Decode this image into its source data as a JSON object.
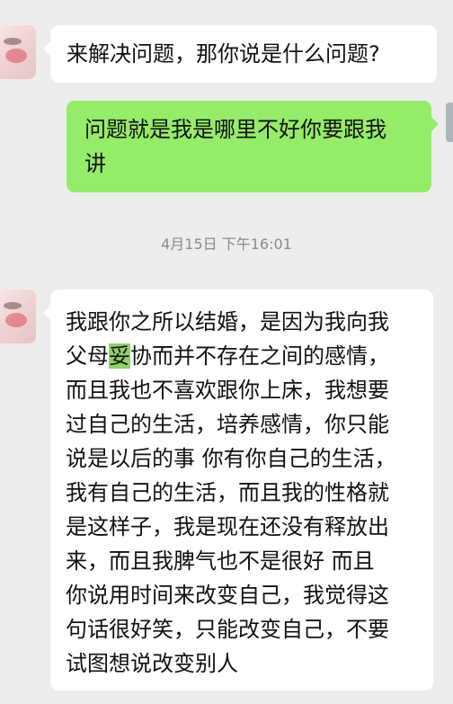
{
  "messages": [
    {
      "side": "left",
      "lines": [
        "来解决问题，那你说是什么问题?"
      ]
    },
    {
      "side": "right",
      "lines": [
        "问题就是我是哪里不好你要跟我",
        "讲"
      ]
    },
    {
      "side": "left",
      "lines": [
        "我跟你之所以结婚，是因为我向我",
        {
          "pre": "父母",
          "hl": "妥",
          "post": "协而并不存在之间的感情，"
        },
        "而且我也不喜欢跟你上床，我想要",
        "过自己的生活，培养感情，你只能",
        "说是以后的事 你有你自己的生活，",
        "我有自己的生活，而且我的性格就",
        "是这样子，我是现在还没有释放出",
        "来，而且我脾气也不是很好 而且",
        "你说用时间来改变自己，我觉得这",
        "句话很好笑，只能改变自己，不要",
        "试图想说改变别人"
      ]
    }
  ],
  "timestamp": "4月15日 下午16:01",
  "colors": {
    "background": "#ededed",
    "sent_bubble": "#95ec69",
    "received_bubble": "#ffffff",
    "timestamp": "#8a8a8a"
  }
}
